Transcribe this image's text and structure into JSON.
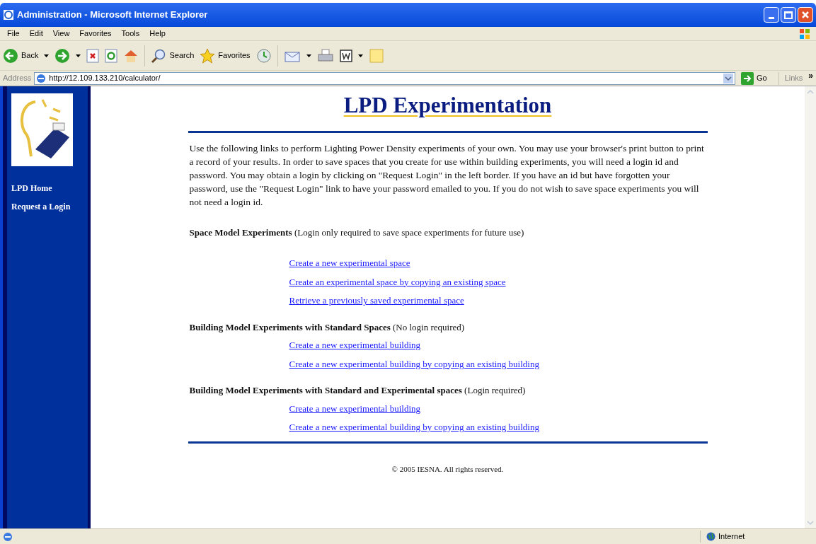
{
  "window": {
    "title": "Administration - Microsoft Internet Explorer"
  },
  "menu": [
    "File",
    "Edit",
    "View",
    "Favorites",
    "Tools",
    "Help"
  ],
  "toolbar": {
    "back": "Back",
    "search": "Search",
    "favorites": "Favorites"
  },
  "address": {
    "label": "Address",
    "value": "http://12.109.133.210/calculator/",
    "go": "Go",
    "links": "Links",
    "more": "»"
  },
  "sidebar": {
    "items": [
      "LPD Home",
      "Request a Login"
    ]
  },
  "page": {
    "title": "LPD Experimentation",
    "intro": "Use the following links to perform Lighting Power Density experiments of your own.  You may use your browser's print button to print a record of your results.  In order to save spaces that you create for use within building experiments, you will need a login id and password.  You may obtain a login by clicking on \"Request Login\" in the left border.  If you have an id but have forgotten your password, use the \"Request Login\" link to have your password emailed to you.  If you do not wish to save space experiments you will not need a login id.",
    "sections": [
      {
        "heading": "Space Model Experiments",
        "note": "(Login only required to save space experiments for future use)",
        "links": [
          "Create a new experimental space",
          "Create an experimental space by copying an existing space",
          "Retrieve a previously saved experimental space"
        ]
      },
      {
        "heading": "Building Model Experiments with Standard Spaces",
        "note": "(No login required)",
        "links": [
          "Create a new experimental building",
          "Create a new experimental building by copying an existing building"
        ]
      },
      {
        "heading": "Building Model Experiments with Standard and Experimental spaces",
        "note": "(Login required)",
        "links": [
          "Create a new experimental building",
          "Create a new experimental building by copying an existing building"
        ]
      }
    ],
    "footer": "© 2005 IESNA. All rights reserved."
  },
  "status_bar": {
    "zone": "Internet"
  }
}
